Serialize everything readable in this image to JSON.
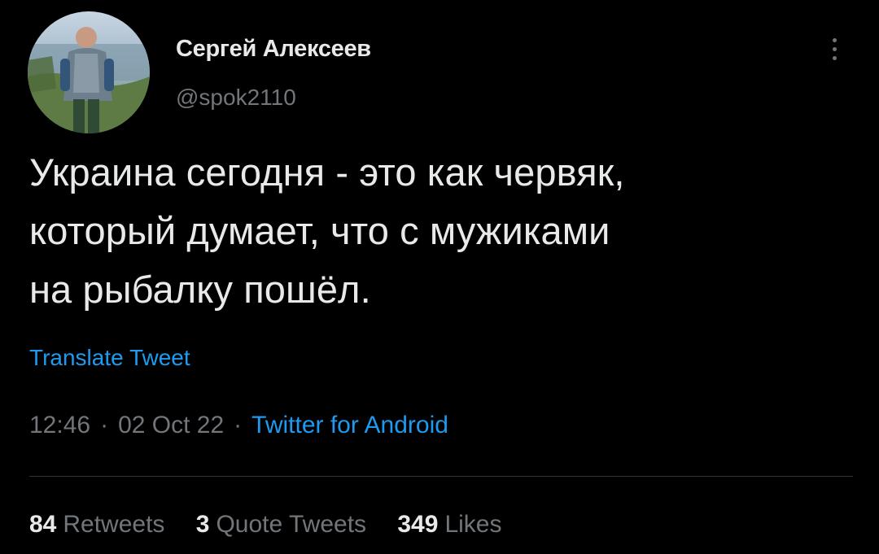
{
  "tweet": {
    "author": {
      "display_name": "Сергей Алексеев",
      "handle": "@spok2110",
      "avatar": "person-photo-avatar"
    },
    "more_icon": "more-vertical-icon",
    "text_lines": [
      "Украина сегодня - это как червяк,",
      "который думает, что с мужиками",
      "на рыбалку пошёл."
    ],
    "translate_label": "Translate Tweet",
    "time": "12:46",
    "date": "02 Oct 22",
    "separator": "·",
    "source": "Twitter for Android",
    "stats": {
      "retweets_count": "84",
      "retweets_label": "Retweets",
      "quotes_count": "3",
      "quotes_label": "Quote Tweets",
      "likes_count": "349",
      "likes_label": "Likes"
    }
  },
  "colors": {
    "background": "#000000",
    "primary_text": "#e7e9ea",
    "secondary_text": "#71767b",
    "accent": "#1d9bf0",
    "divider": "#2f3336"
  }
}
